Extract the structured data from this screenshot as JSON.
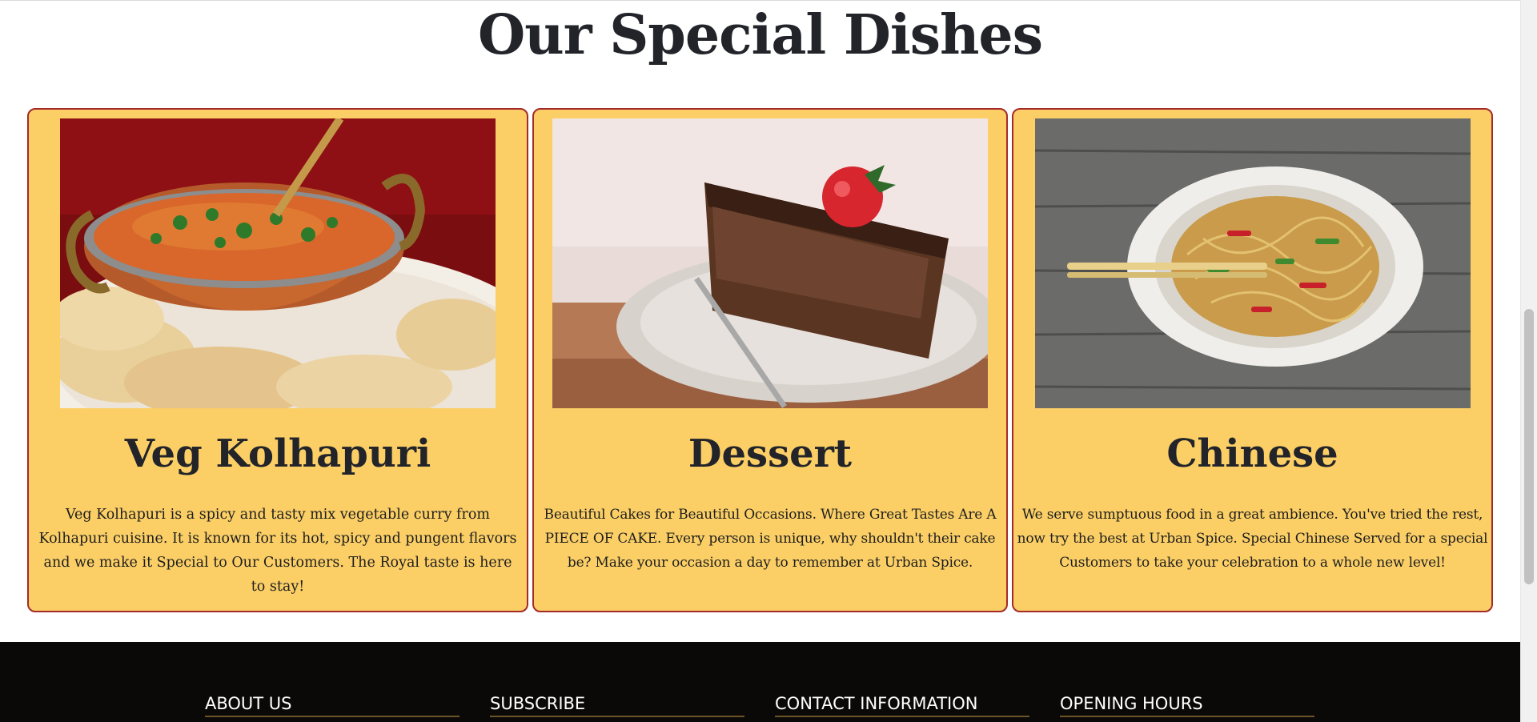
{
  "section": {
    "title": "Our Special Dishes"
  },
  "cards": [
    {
      "title": "Veg Kolhapuri",
      "description": "Veg Kolhapuri is a spicy and tasty mix vegetable curry from Kolhapuri cuisine. It is known for its hot, spicy and pungent flavors and we make it Special to Our Customers. The Royal taste is here to stay!",
      "image_icon": "curry-bowl-photo"
    },
    {
      "title": "Dessert",
      "description": "Beautiful Cakes for Beautiful Occasions. Where Great Tastes Are A PIECE OF CAKE. Every person is unique, why shouldn't their cake be? Make your occasion a day to remember at Urban Spice.",
      "image_icon": "chocolate-cake-photo"
    },
    {
      "title": "Chinese",
      "description": "We serve sumptuous food in a great ambience. You've tried the rest, now try the best at Urban Spice. Special Chinese Served for a special Customers to take your celebration to a whole new level!",
      "image_icon": "noodles-bowl-photo"
    }
  ],
  "footer": {
    "headings": [
      "ABOUT US",
      "SUBSCRIBE",
      "CONTACT INFORMATION",
      "OPENING HOURS"
    ]
  },
  "colors": {
    "card_background": "#fbcf66",
    "card_border": "#a52a2a",
    "footer_background": "#0b0908",
    "heading_text": "#22242a"
  }
}
